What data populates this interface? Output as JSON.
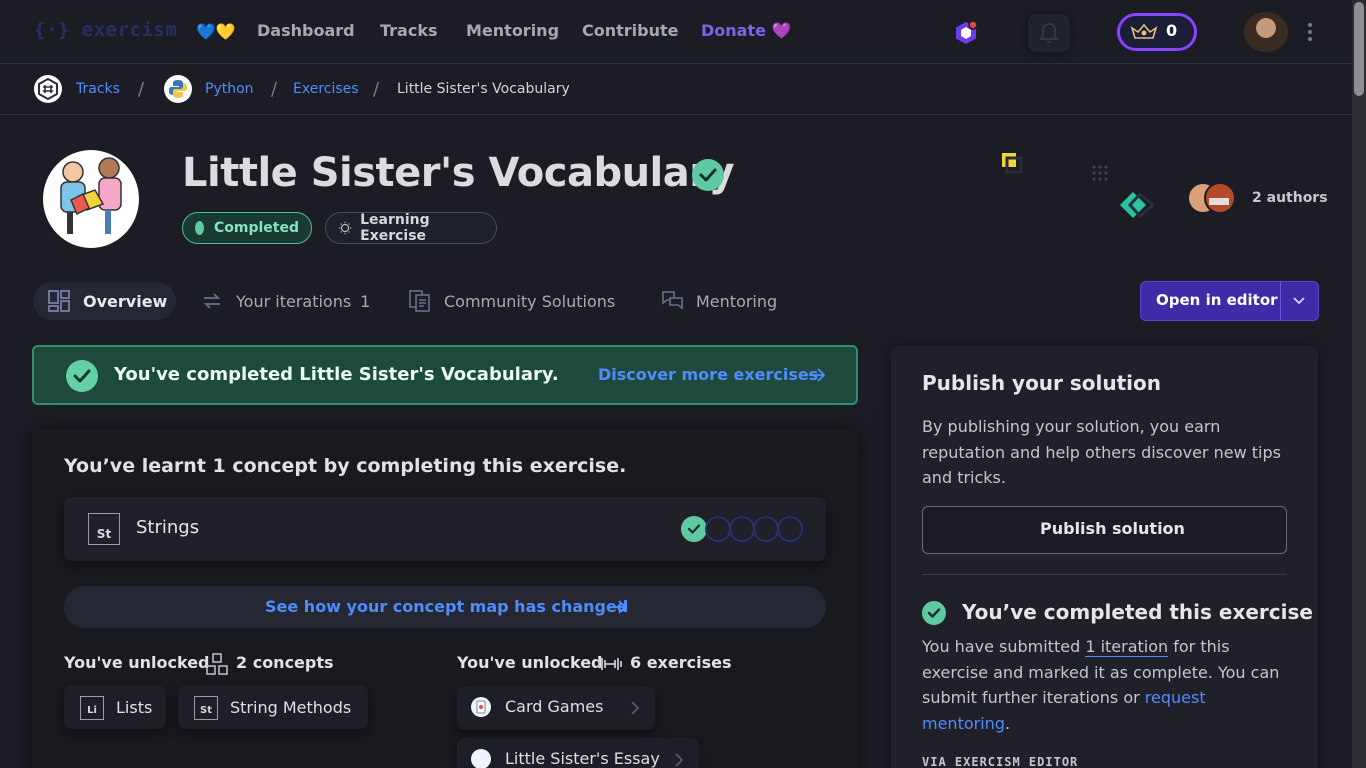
{
  "nav": {
    "logo": "{·} exercism",
    "flag": "💙💛",
    "links": [
      "Dashboard",
      "Tracks",
      "Mentoring",
      "Contribute"
    ],
    "donate": "Donate 💜",
    "reputation": "0"
  },
  "breadcrumb": {
    "tracks": "Tracks",
    "python": "Python",
    "exercises": "Exercises",
    "current": "Little Sister's Vocabulary",
    "separator": "/"
  },
  "exercise": {
    "title": "Little Sister's Vocabulary",
    "status_pill": "Completed",
    "type_pill": "Learning Exercise",
    "authors": "2 authors"
  },
  "tabs": {
    "overview": "Overview",
    "iterations": "Your iterations",
    "iterations_count": "1",
    "community": "Community Solutions",
    "mentoring": "Mentoring"
  },
  "editor_button": "Open in editor",
  "banner": {
    "text": "You've completed Little Sister's Vocabulary.",
    "link": "Discover more exercises"
  },
  "learnt": {
    "heading": "You’ve learnt 1 concept by completing this exercise.",
    "concept_abbr": "St",
    "concept_name": "Strings",
    "progress_completed": 1,
    "progress_total": 5,
    "concept_map_link": "See how your concept map has changed"
  },
  "unlocked": {
    "concepts_label": "You've unlocked",
    "concepts_count": "2 concepts",
    "concepts": [
      {
        "abbr": "Li",
        "name": "Lists"
      },
      {
        "abbr": "St",
        "name": "String Methods"
      }
    ],
    "exercises_label": "You've unlocked",
    "exercises_count": "6 exercises",
    "exercises": [
      "Card Games",
      "Little Sister's Essay"
    ]
  },
  "sidebar": {
    "title": "Publish your solution",
    "body": "By publishing your solution, you earn reputation and help others discover new tips and tricks.",
    "publish_button": "Publish solution",
    "completed_title": "You’ve completed this exercise",
    "completed_text_1": "You have submitted ",
    "completed_link_1": "1 iteration",
    "completed_text_2": " for this exercise and marked it as complete. You can submit further iterations or ",
    "completed_link_2": "request mentoring",
    "completed_text_3": ".",
    "via": "VIA EXERCISM EDITOR"
  },
  "colors": {
    "accent": "#4f8dff",
    "success": "#5fc9a3",
    "primary_button": "#3f2ba8",
    "background": "#1c1d24"
  }
}
